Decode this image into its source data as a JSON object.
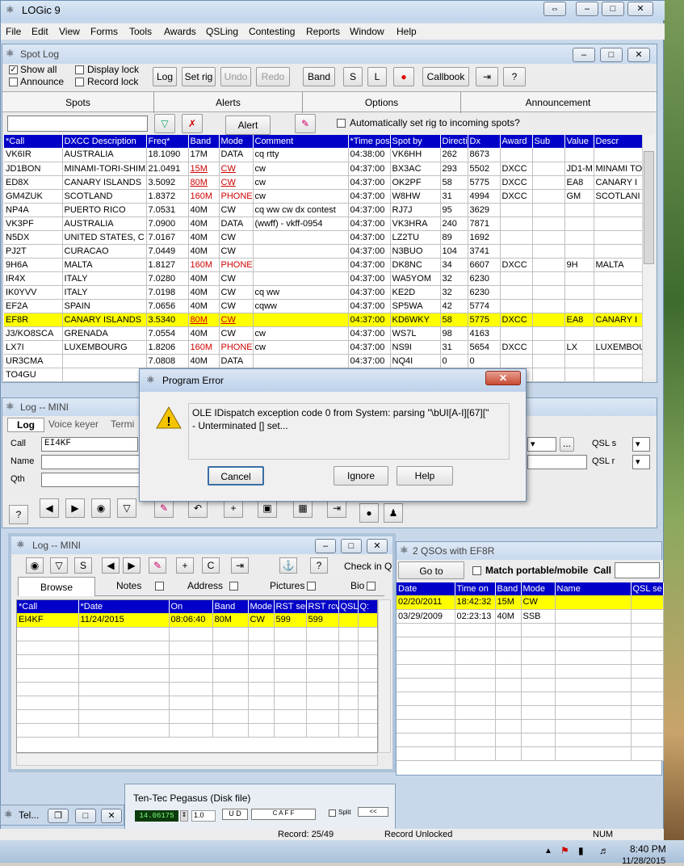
{
  "app": {
    "title": "LOGic 9"
  },
  "menu": [
    "File",
    "Edit",
    "View",
    "Forms",
    "Tools",
    "Awards",
    "QSLing",
    "Contesting",
    "Reports",
    "Window",
    "Help"
  ],
  "spotlog": {
    "title": "Spot Log",
    "options": {
      "show_all": "Show all",
      "announce": "Announce",
      "display_lock": "Display lock",
      "record_lock": "Record lock"
    },
    "toolbar": {
      "log": "Log",
      "set_rig": "Set rig",
      "undo": "Undo",
      "redo": "Redo",
      "band": "Band",
      "s": "S",
      "l": "L",
      "callbook": "Callbook"
    },
    "tabs": [
      "Spots",
      "Alerts",
      "Options",
      "Announcement"
    ],
    "alert_label": "Alert",
    "auto_set_rig": "Automatically set rig to incoming spots?",
    "columns": [
      "*Call",
      "DXCC Description",
      "Freq*",
      "Band",
      "Mode",
      "Comment",
      "*Time post",
      "Spot by",
      "Directi",
      "Dx",
      "Award",
      "Sub",
      "Value",
      "Descr"
    ],
    "rows": [
      [
        "VK6IR",
        "AUSTRALIA",
        "18.1090",
        "17M",
        "DATA",
        "cq rtty",
        "04:38:00",
        "VK6HH",
        "262",
        "8673",
        "",
        "",
        "",
        ""
      ],
      [
        "JD1BON",
        "MINAMI-TORI-SHIM",
        "21.0491",
        "15M",
        "CW",
        "cw",
        "04:37:00",
        "BX3AC",
        "293",
        "5502",
        "DXCC",
        "",
        "JD1-M",
        "MINAMI TO"
      ],
      [
        "ED8X",
        "CANARY ISLANDS",
        "3.5092",
        "80M",
        "CW",
        "cw",
        "04:37:00",
        "OK2PF",
        "58",
        "5775",
        "DXCC",
        "",
        "EA8",
        "CANARY I"
      ],
      [
        "GM4ZUK",
        "SCOTLAND",
        "1.8372",
        "160M",
        "PHONE",
        "cw",
        "04:37:00",
        "W8HW",
        "31",
        "4994",
        "DXCC",
        "",
        "GM",
        "SCOTLANI"
      ],
      [
        "NP4A",
        "PUERTO RICO",
        "7.0531",
        "40M",
        "CW",
        "cq ww cw dx contest",
        "04:37:00",
        "RJ7J",
        "95",
        "3629",
        "",
        "",
        "",
        ""
      ],
      [
        "VK3PF",
        "AUSTRALIA",
        "7.0900",
        "40M",
        "DATA",
        "(wwff) - vkff-0954",
        "04:37:00",
        "VK3HRA",
        "240",
        "7871",
        "",
        "",
        "",
        ""
      ],
      [
        "N5DX",
        "UNITED STATES, C",
        "7.0167",
        "40M",
        "CW",
        "",
        "04:37:00",
        "LZ2TU",
        "89",
        "1692",
        "",
        "",
        "",
        ""
      ],
      [
        "PJ2T",
        "CURACAO",
        "7.0449",
        "40M",
        "CW",
        "",
        "04:37:00",
        "N3BUO",
        "104",
        "3741",
        "",
        "",
        "",
        ""
      ],
      [
        "9H6A",
        "MALTA",
        "1.8127",
        "160M",
        "PHONE",
        "",
        "04:37:00",
        "DK8NC",
        "34",
        "6607",
        "DXCC",
        "",
        "9H",
        "MALTA"
      ],
      [
        "IR4X",
        "ITALY",
        "7.0280",
        "40M",
        "CW",
        "",
        "04:37:00",
        "WA5YOM",
        "32",
        "6230",
        "",
        "",
        "",
        ""
      ],
      [
        "IK0YVV",
        "ITALY",
        "7.0198",
        "40M",
        "CW",
        "cq ww",
        "04:37:00",
        "KE2D",
        "32",
        "6230",
        "",
        "",
        "",
        ""
      ],
      [
        "EF2A",
        "SPAIN",
        "7.0656",
        "40M",
        "CW",
        "cqww",
        "04:37:00",
        "SP5WA",
        "42",
        "5774",
        "",
        "",
        "",
        ""
      ],
      [
        "EF8R",
        "CANARY ISLANDS",
        "3.5340",
        "80M",
        "CW",
        "",
        "04:37:00",
        "KD6WKY",
        "58",
        "5775",
        "DXCC",
        "",
        "EA8",
        "CANARY I"
      ],
      [
        "J3/KO8SCA",
        "GRENADA",
        "7.0554",
        "40M",
        "CW",
        "cw",
        "04:37:00",
        "WS7L",
        "98",
        "4163",
        "",
        "",
        "",
        ""
      ],
      [
        "LX7I",
        "LUXEMBOURG",
        "1.8206",
        "160M",
        "PHONE",
        "cw",
        "04:37:00",
        "NS9I",
        "31",
        "5654",
        "DXCC",
        "",
        "LX",
        "LUXEMBOU"
      ],
      [
        "UR3CMA",
        "",
        "7.0808",
        "40M",
        "DATA",
        "",
        "04:37:00",
        "NQ4I",
        "0",
        "0",
        "",
        "",
        "",
        ""
      ],
      [
        "TO4GU",
        "",
        "",
        "",
        "",
        "",
        "",
        "",
        "",
        "",
        "",
        "",
        "",
        ""
      ]
    ]
  },
  "error_dialog": {
    "title": "Program Error",
    "message1": "OLE IDispatch exception code 0 from System: parsing \"\\bUI[A-I][67][\"",
    "message2": "- Unterminated [] set...",
    "cancel": "Cancel",
    "ignore": "Ignore",
    "help": "Help"
  },
  "logmini1": {
    "title": "Log -- MINI",
    "tabs": [
      "Log",
      "Voice keyer",
      "Termi"
    ],
    "call_label": "Call",
    "call_value": "EI4KF",
    "name_label": "Name",
    "qth_label": "Qth",
    "qsl_s": "QSL s",
    "qsl_r": "QSL r"
  },
  "logmini2": {
    "title": "Log -- MINI",
    "tb_s": "S",
    "tb_c": "C",
    "check_in": "Check in Q",
    "tabs": [
      "Browse",
      "Notes",
      "Address",
      "Pictures",
      "Bio"
    ],
    "columns": [
      "*Call",
      "*Date",
      "On",
      "Band",
      "Mode",
      "RST ser",
      "RST rcv",
      "QSL",
      "Q:"
    ],
    "rows": [
      [
        "EI4KF",
        "11/24/2015",
        "08:06:40",
        "80M",
        "CW",
        "599",
        "599",
        "",
        ""
      ]
    ]
  },
  "qsos": {
    "title": "2 QSOs with EF8R",
    "goto": "Go to",
    "match": "Match portable/mobile",
    "call_label": "Call",
    "columns": [
      "Date",
      "Time on",
      "Band",
      "Mode",
      "Name",
      "QSL se"
    ],
    "rows": [
      [
        "02/20/2011",
        "18:42:32",
        "15M",
        "CW",
        "",
        ""
      ],
      [
        "03/29/2009",
        "02:23:13",
        "40M",
        "SSB",
        "",
        ""
      ]
    ]
  },
  "rig": {
    "title": "Ten-Tec Pegasus (Disk file)",
    "freq": "14.06175",
    "step": "1.0",
    "split": "Split"
  },
  "minimized": {
    "label": "Tel..."
  },
  "status": {
    "record": "Record: 25/49",
    "lock": "Record Unlocked",
    "num": "NUM"
  },
  "taskbar": {
    "time": "8:40 PM",
    "date": "11/28/2015"
  }
}
